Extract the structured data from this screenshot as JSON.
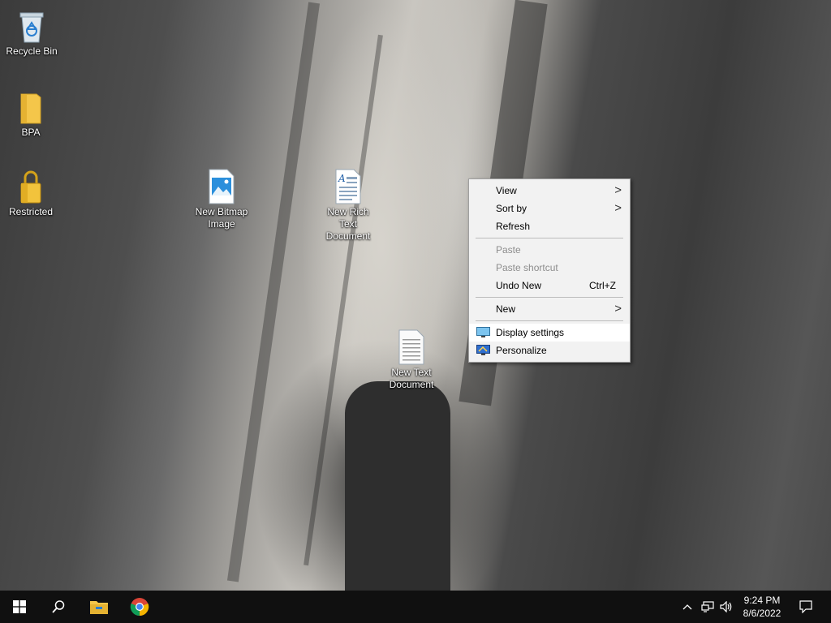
{
  "desktop_icons": [
    {
      "label": "Recycle Bin",
      "icon": "recycle-bin-icon"
    },
    {
      "label": "BPA",
      "icon": "folder-icon"
    },
    {
      "label": "Restricted",
      "icon": "lock-folder-icon"
    },
    {
      "label": "New Bitmap Image",
      "icon": "bitmap-file-icon"
    },
    {
      "label": "New Rich Text Document",
      "icon": "rich-text-file-icon"
    },
    {
      "label": "New Text Document",
      "icon": "text-file-icon"
    }
  ],
  "context_menu": {
    "view": "View",
    "sort_by": "Sort by",
    "refresh": "Refresh",
    "paste": "Paste",
    "paste_shortcut": "Paste shortcut",
    "undo_new": "Undo New",
    "undo_new_shortcut": "Ctrl+Z",
    "new": "New",
    "display_settings": "Display settings",
    "personalize": "Personalize",
    "submenu_arrow": ">"
  },
  "taskbar": {
    "start": "windows-start-icon",
    "search": "search-icon",
    "pinned": [
      "file-explorer-icon",
      "chrome-icon"
    ],
    "tray_icons": [
      "chevron-up-icon",
      "network-icon",
      "volume-icon"
    ],
    "time": "9:24 PM",
    "date": "8/6/2022",
    "notifications": "action-center-icon"
  },
  "colors": {
    "taskbar_bg": "#101010",
    "menu_bg": "#f2f2f2",
    "folder_yellow": "#f4c64a",
    "windows_blue": "#0078d7"
  }
}
